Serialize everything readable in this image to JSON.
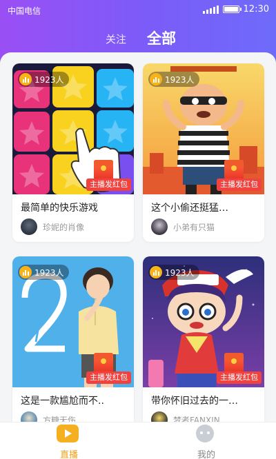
{
  "status_bar": {
    "carrier": "中国电信",
    "time": "12:30"
  },
  "tabs": [
    {
      "label": "关注",
      "active": false
    },
    {
      "label": "全部",
      "active": true
    }
  ],
  "cards": [
    {
      "viewers": "1923人",
      "badge": "主播发红包",
      "title": "最简单的快乐游戏",
      "author": "珍妮的肖像"
    },
    {
      "viewers": "1923人",
      "badge": "主播发红包",
      "title": "这个小偷还挺猛…",
      "author": "小弟有只猫"
    },
    {
      "viewers": "1923人",
      "badge": "主播发红包",
      "title": "这是一款尴尬而不..",
      "author": "方糖无伤"
    },
    {
      "viewers": "1923人",
      "badge": "主播发红包",
      "title": "带你怀旧过去的一…",
      "author": "梦者FANXIN"
    }
  ],
  "bottom_nav": [
    {
      "label": "直播",
      "active": true,
      "icon": "play-icon"
    },
    {
      "label": "我的",
      "active": false,
      "icon": "profile-icon"
    }
  ],
  "colors": {
    "header_start": "#9a4ff5",
    "header_end": "#6e6bfa",
    "accent": "#f2a216",
    "badge": "#f0433f"
  }
}
